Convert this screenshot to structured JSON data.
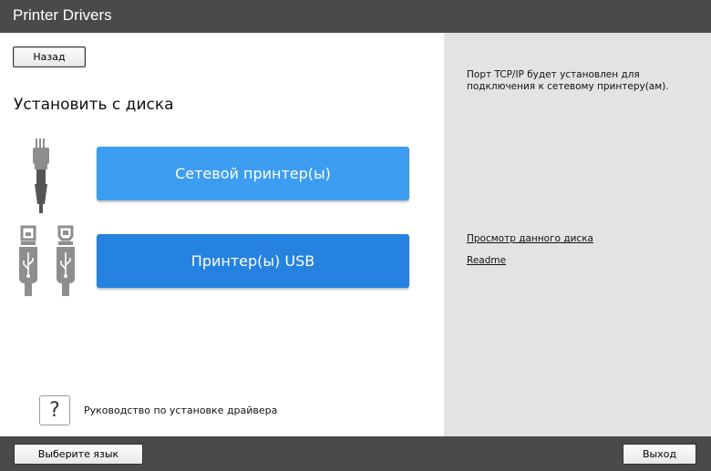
{
  "window": {
    "title": "Printer Drivers"
  },
  "left": {
    "back_label": "Назад",
    "heading": "Установить с диска",
    "network_button_label": "Сетевой принтер(ы)",
    "usb_button_label": "Принтер(ы) USB",
    "help_icon_text": "?",
    "help_label": "Руководство по установке драйвера"
  },
  "right": {
    "info_text": "Порт TCP/IP будет установлен для подключения к сетевому принтеру(ам).",
    "links": {
      "browse_disc": "Просмотр данного диска",
      "readme": "Readme"
    }
  },
  "bottom": {
    "language_label": "Выберите язык",
    "exit_label": "Выход"
  },
  "icons": {
    "ethernet": "ethernet-cable-icon",
    "usb_a": "usb-a-cable-icon",
    "usb_b": "usb-b-cable-icon",
    "help": "question-mark-icon"
  },
  "colors": {
    "network_button": "#3d9ef1",
    "usb_button": "#2582e0",
    "titlebar": "#4a4a4a",
    "right_panel": "#e3e3e3"
  }
}
